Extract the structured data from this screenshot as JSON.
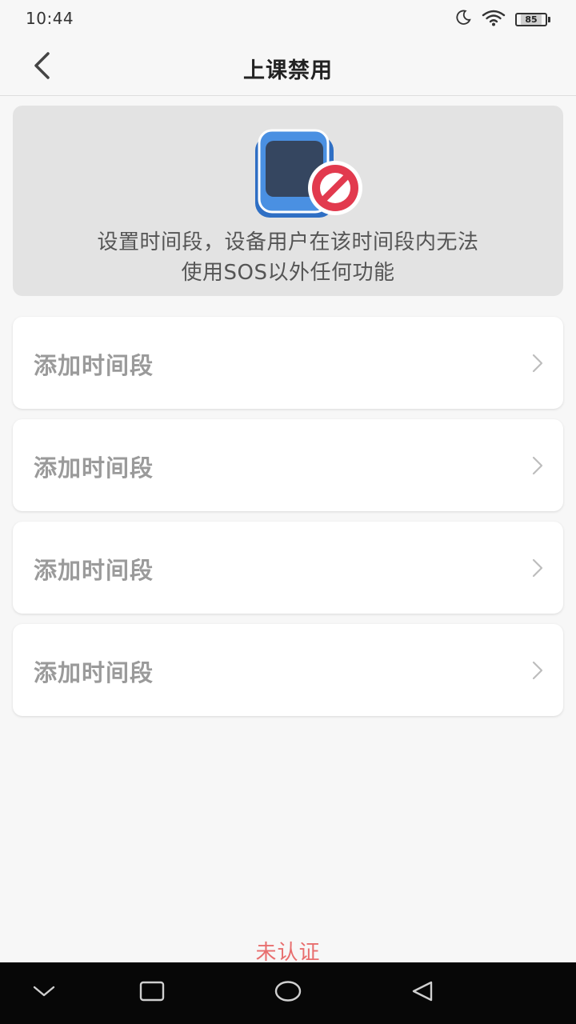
{
  "status_bar": {
    "time": "10:44",
    "battery_level": "85",
    "icons": [
      "moon-icon",
      "wifi-icon",
      "battery-icon"
    ]
  },
  "header": {
    "title": "上课禁用",
    "back_icon": "chevron-left-icon"
  },
  "info_card": {
    "illustration": "watch-blocked-icon",
    "line1": "设置时间段，设备用户在该时间段内无法",
    "line2": "使用SOS以外任何功能"
  },
  "time_slots": [
    {
      "label": "添加时间段"
    },
    {
      "label": "添加时间段"
    },
    {
      "label": "添加时间段"
    },
    {
      "label": "添加时间段"
    }
  ],
  "footer": {
    "note": "未认证"
  },
  "nav_bar": {
    "buttons": [
      "chevron-down-icon",
      "square-icon",
      "circle-icon",
      "triangle-back-icon"
    ]
  },
  "colors": {
    "background": "#f7f7f7",
    "card": "#ffffff",
    "info_card": "#e3e3e3",
    "watch_blue": "#4a90e2",
    "forbid_red": "#e23a4e",
    "footer_red": "#e86e6e",
    "nav_bar": "#070707"
  }
}
